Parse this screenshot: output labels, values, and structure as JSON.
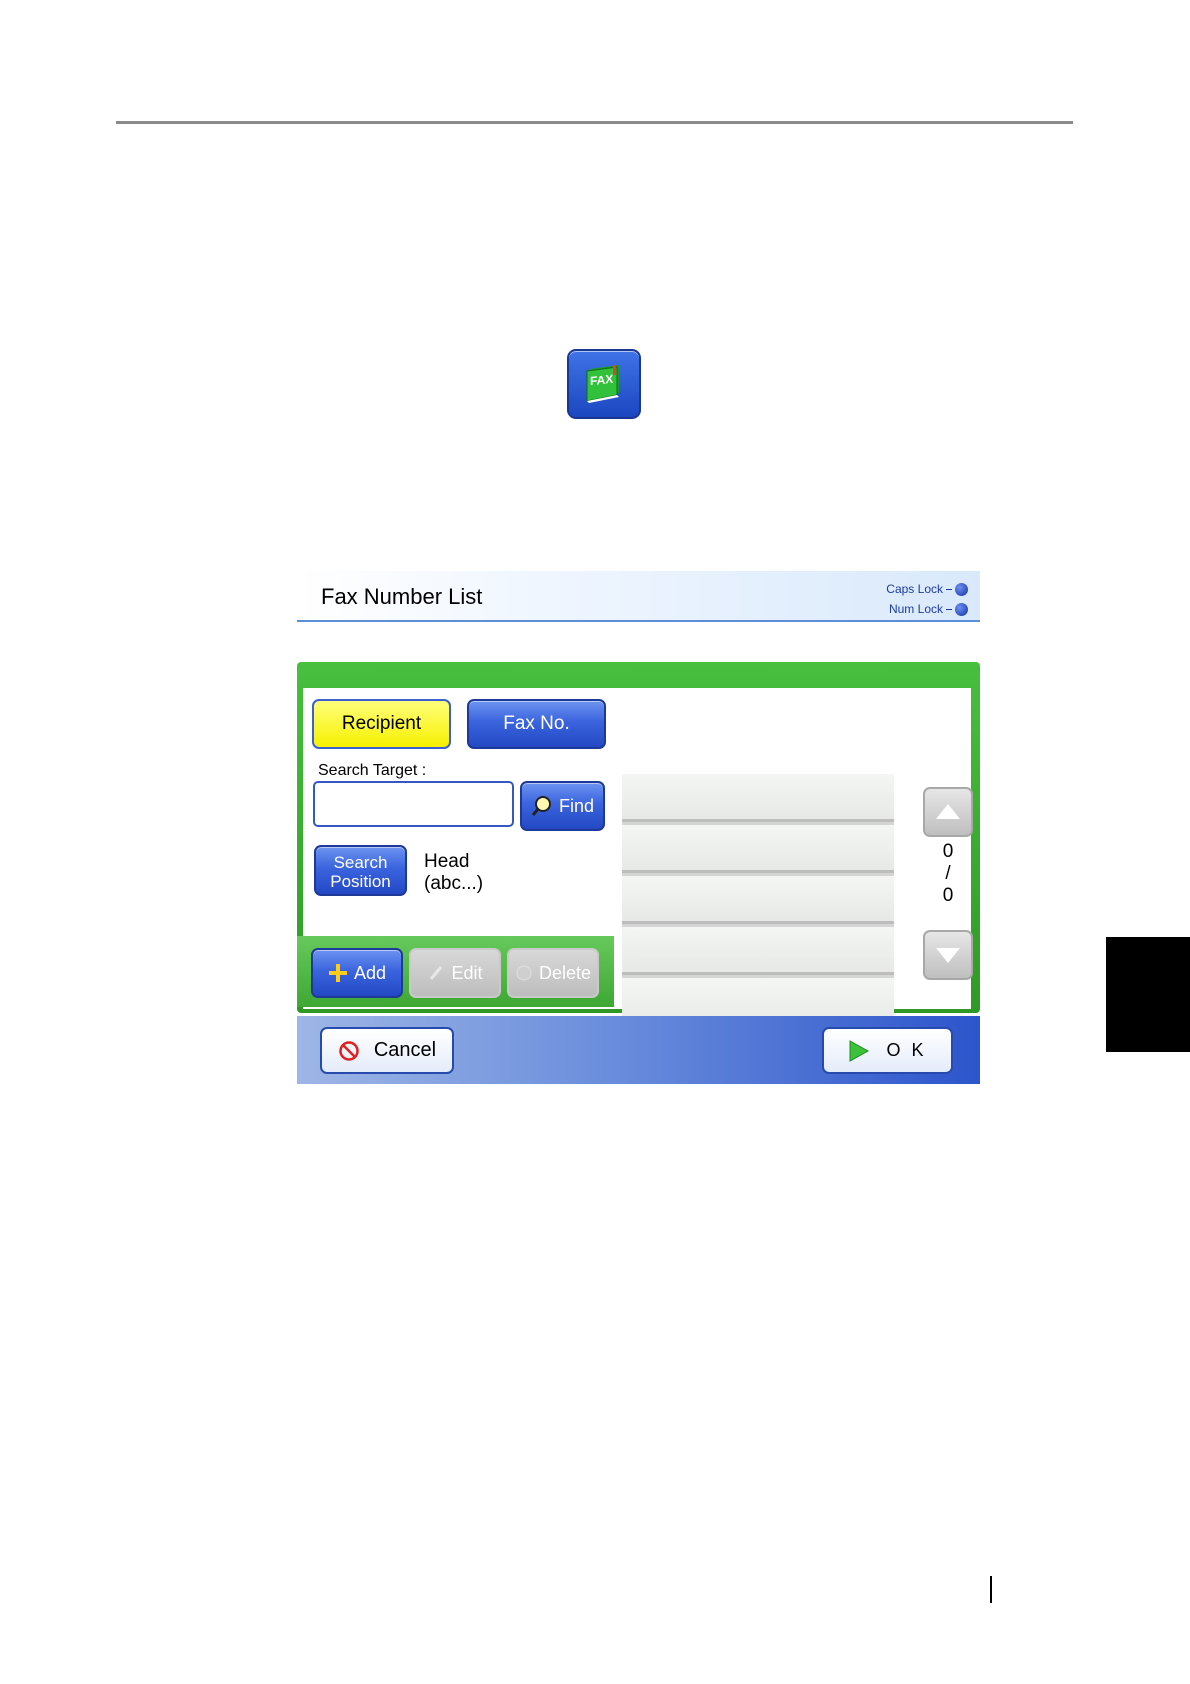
{
  "header": {
    "title": "Fax Number List",
    "caps_lock": "Caps Lock",
    "num_lock": "Num Lock"
  },
  "tabs": {
    "recipient": "Recipient",
    "fax_no": "Fax No."
  },
  "search": {
    "target_label": "Search Target :",
    "input_value": "",
    "find_label": "Find",
    "position_label_line1": "Search",
    "position_label_line2": "Position",
    "position_value_line1": "Head",
    "position_value_line2": "(abc...)"
  },
  "actions": {
    "add": "Add",
    "edit": "Edit",
    "delete": "Delete"
  },
  "list": {
    "rows": [
      "",
      "",
      "",
      "",
      ""
    ],
    "current": "0",
    "separator": "/",
    "total": "0"
  },
  "footer": {
    "cancel": "Cancel",
    "ok": "O K"
  },
  "icons": [
    "fax-book-icon",
    "search-icon",
    "plus-icon",
    "pencil-icon",
    "delete-icon",
    "cancel-icon",
    "play-icon",
    "arrow-up-icon",
    "arrow-down-icon"
  ],
  "colors": {
    "selected_tab": "#f6f000",
    "accent_blue": "#2448c4",
    "panel_green": "#3ea833"
  }
}
